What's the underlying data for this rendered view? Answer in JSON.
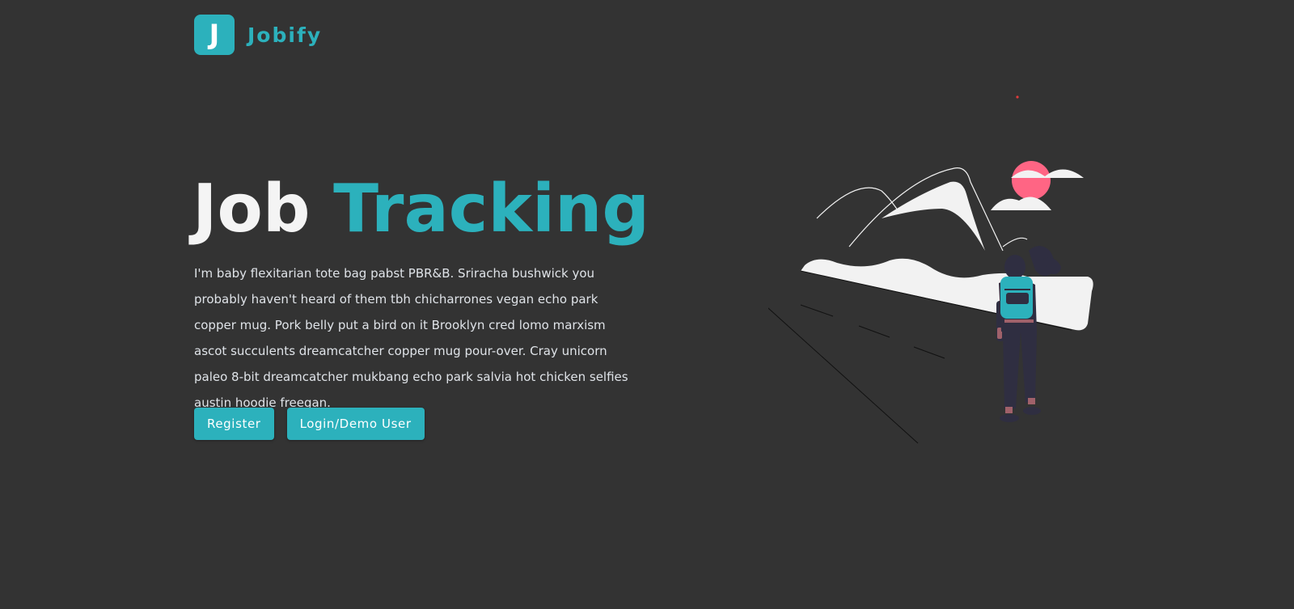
{
  "brand": {
    "logo_letter": "J",
    "name": "Jobify",
    "primary_color": "#2cb1bc"
  },
  "hero": {
    "title_main": "Job",
    "title_accent": "Tracking",
    "description": "I'm baby flexitarian tote bag pabst PBR&B. Sriracha bushwick you probably haven't heard of them tbh chicharrones vegan echo park copper mug. Pork belly put a bird on it Brooklyn cred lomo marxism ascot succulents dreamcatcher copper mug pour-over. Cray unicorn paleo 8-bit dreamcatcher mukbang echo park salvia hot chicken selfies austin hoodie freegan.",
    "buttons": {
      "register": "Register",
      "login": "Login/Demo User"
    }
  },
  "illustration": {
    "name": "traveler-mountains-illustration",
    "colors": {
      "mountain": "#f2f2f2",
      "sun": "#ff6584",
      "backpack": "#2cb1bc",
      "figure": "#2f2e41",
      "skin": "#a0616a"
    }
  }
}
